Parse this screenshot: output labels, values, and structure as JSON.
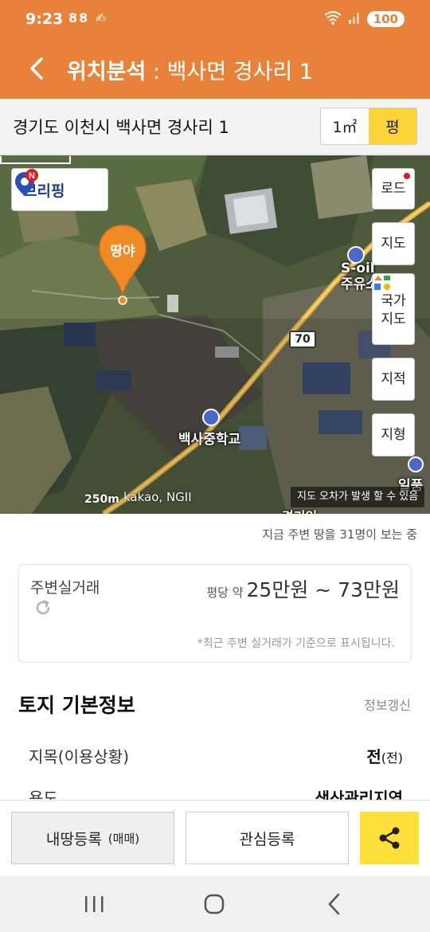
{
  "status_bar": {
    "time": "9:23",
    "left_icons": "88 ✍",
    "battery": "100"
  },
  "header": {
    "title_main": "위치분석",
    "title_sep": " : ",
    "title_place": "백사면 경사리 1"
  },
  "address": {
    "text": "경기도 이천시 백사면 경사리 1",
    "unit_sqm": "1㎡",
    "unit_pyeong": "평",
    "active_unit": "평"
  },
  "map": {
    "bripping_label": "브리핑",
    "bripping_badge": "N",
    "pin_label": "땅야",
    "side_buttons": {
      "road": "로드",
      "map": "지도",
      "national_line1": "국가",
      "national_line2": "지도",
      "cadastral": "지적",
      "terrain": "지형"
    },
    "labels": {
      "soil_line1": "S-oil",
      "soil_line2": "주유소",
      "route": "70",
      "school": "백사중학교",
      "food": "일품",
      "bottom_label": "경기인"
    },
    "scale": "250m",
    "attribution": "kakao, NGII",
    "notice": "지도 오차가 발생 할 수 있음"
  },
  "viewers_text": "지금 주변 땅을 31명이 보는 중",
  "trade": {
    "title": "주변실거래",
    "price_prefix": "평당 약",
    "price_range": "25만원 ~ 73만원",
    "note": "*최근 주변 실거래가 기준으로 표시됩니다."
  },
  "basic_info": {
    "title": "토지 기본정보",
    "action": "정보갱신",
    "rows": [
      {
        "label": "지목(이용상황)",
        "value": "전",
        "sub": "(전)"
      },
      {
        "label": "용도",
        "value": "생산관리지역",
        "sub": ""
      }
    ]
  },
  "bottom_actions": {
    "register": "내땅등록",
    "register_sub": "(매매)",
    "interest": "관심등록"
  }
}
